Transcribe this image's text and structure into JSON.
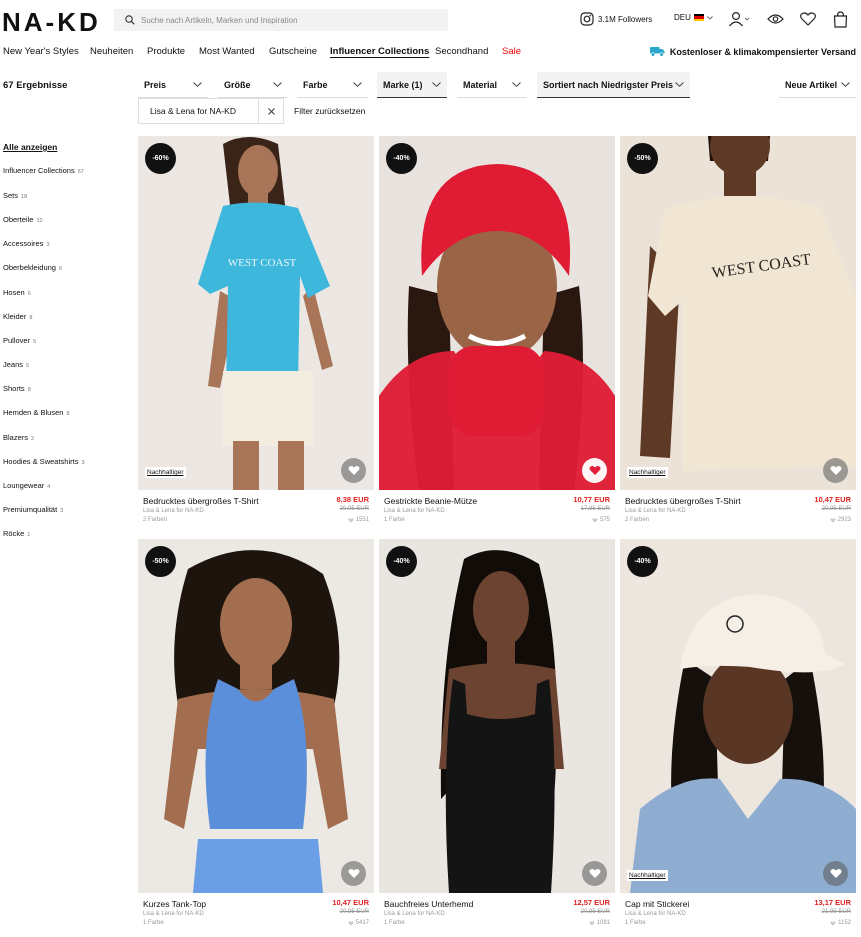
{
  "header": {
    "logo": "NA-KD",
    "search_placeholder": "Suche nach Artikeln, Marken und Inspiration",
    "instagram_followers": "3.1M Followers",
    "language": "DEU"
  },
  "nav": {
    "items": [
      {
        "label": "New Year's Styles"
      },
      {
        "label": "Neuheiten"
      },
      {
        "label": "Produkte"
      },
      {
        "label": "Most Wanted"
      },
      {
        "label": "Gutscheine"
      },
      {
        "label": "Influencer Collections",
        "active": true
      },
      {
        "label": "Secondhand"
      },
      {
        "label": "Sale",
        "sale": true
      }
    ],
    "shipping_text": "Kostenloser & klimakompensierter Versand"
  },
  "results": {
    "count_text": "67 Ergebnisse"
  },
  "filters": {
    "items": [
      {
        "label": "Preis"
      },
      {
        "label": "Größe"
      },
      {
        "label": "Farbe"
      },
      {
        "label": "Marke (1)",
        "selected": true
      },
      {
        "label": "Material"
      },
      {
        "label": "Sortiert nach Niedrigster Preis",
        "selected": true
      }
    ],
    "new_items_label": "Neue Artikel",
    "active_chip": "Lisa & Lena for NA-KD",
    "reset_label": "Filter zurücksetzen"
  },
  "sidebar": {
    "show_all": "Alle anzeigen",
    "categories": [
      {
        "label": "Influencer Collections",
        "count": "67"
      },
      {
        "label": "Sets",
        "count": "18"
      },
      {
        "label": "Oberteile",
        "count": "12"
      },
      {
        "label": "Accessoires",
        "count": "3"
      },
      {
        "label": "Oberbekleidung",
        "count": "6"
      },
      {
        "label": "Hosen",
        "count": "6"
      },
      {
        "label": "Kleider",
        "count": "8"
      },
      {
        "label": "Pullover",
        "count": "5"
      },
      {
        "label": "Jeans",
        "count": "5"
      },
      {
        "label": "Shorts",
        "count": "8"
      },
      {
        "label": "Hemden & Blusen",
        "count": "8"
      },
      {
        "label": "Blazers",
        "count": "2"
      },
      {
        "label": "Hoodies & Sweatshirts",
        "count": "3"
      },
      {
        "label": "Loungewear",
        "count": "4"
      },
      {
        "label": "Premiumqualität",
        "count": "3"
      },
      {
        "label": "Röcke",
        "count": "1"
      }
    ]
  },
  "products": [
    {
      "name": "Bedrucktes übergroßes T-Shirt",
      "brand": "Lisa & Lena for NA-KD",
      "colors": "2 Farben",
      "price": "8,38 EUR",
      "old_price": "20,95 EUR",
      "likes": "1551",
      "discount": "-60%",
      "sustainable": "Nachhaltiger",
      "print": "WEST COAST",
      "bg": "#ece7e2",
      "garment": "#3eb7dd",
      "skin": "#a87558",
      "hair": "#3a2418",
      "heart_filled": false
    },
    {
      "name": "Gestrickte Beanie-Mütze",
      "brand": "Lisa & Lena for NA-KD",
      "colors": "1 Farbe",
      "price": "10,77 EUR",
      "old_price": "17,95 EUR",
      "likes": "575",
      "discount": "-40%",
      "sustainable": "",
      "bg": "#e8e3df",
      "garment": "#e01c35",
      "skin": "#9a6447",
      "hair": "#2a1810",
      "heart_filled": true
    },
    {
      "name": "Bedrucktes übergroßes T-Shirt",
      "brand": "Lisa & Lena for NA-KD",
      "colors": "2 Farben",
      "price": "10,47 EUR",
      "old_price": "20,95 EUR",
      "likes": "2923",
      "discount": "-50%",
      "sustainable": "Nachhaltiger",
      "print": "WEST COAST",
      "bg": "#ece3d8",
      "garment": "#f1e6d3",
      "skin": "#5e3a26",
      "hair": "#1c120c",
      "heart_filled": false
    },
    {
      "name": "Kurzes Tank-Top",
      "brand": "Lisa & Lena for NA-KD",
      "colors": "1 Farbe",
      "price": "10,47 EUR",
      "old_price": "20,95 EUR",
      "likes": "5417",
      "discount": "-50%",
      "sustainable": "",
      "bg": "#ece8e3",
      "garment": "#5b8fd9",
      "skin": "#a26e4f",
      "hair": "#1e140e",
      "heart_filled": false
    },
    {
      "name": "Bauchfreies Unterhemd",
      "brand": "Lisa & Lena for NA-KD",
      "colors": "1 Farbe",
      "price": "12,57 EUR",
      "old_price": "20,95 EUR",
      "likes": "1081",
      "discount": "-40%",
      "sustainable": "",
      "bg": "#e9e5e1",
      "garment": "#141414",
      "skin": "#6b4330",
      "hair": "#120c08",
      "heart_filled": false
    },
    {
      "name": "Cap mit Stickerei",
      "brand": "Lisa & Lena for NA-KD",
      "colors": "1 Farbe",
      "price": "13,17 EUR",
      "old_price": "21,95 EUR",
      "likes": "1152",
      "discount": "-40%",
      "sustainable": "Nachhaltiger",
      "bg": "#ece6df",
      "garment": "#8eadd0",
      "skin": "#5a3624",
      "hair": "#15100c",
      "heart_filled": false
    }
  ],
  "icons": {
    "search": "search-icon",
    "instagram": "instagram-icon",
    "user": "user-icon",
    "eye": "eye-icon",
    "wishlist": "heart-icon",
    "bag": "bag-icon",
    "shipping": "truck-icon",
    "chevron": "chevron-down-icon",
    "close": "close-icon"
  },
  "colors": {
    "sale_red": "#e02020",
    "badge_black": "#111111",
    "accent_teal": "#2aa6c9"
  }
}
